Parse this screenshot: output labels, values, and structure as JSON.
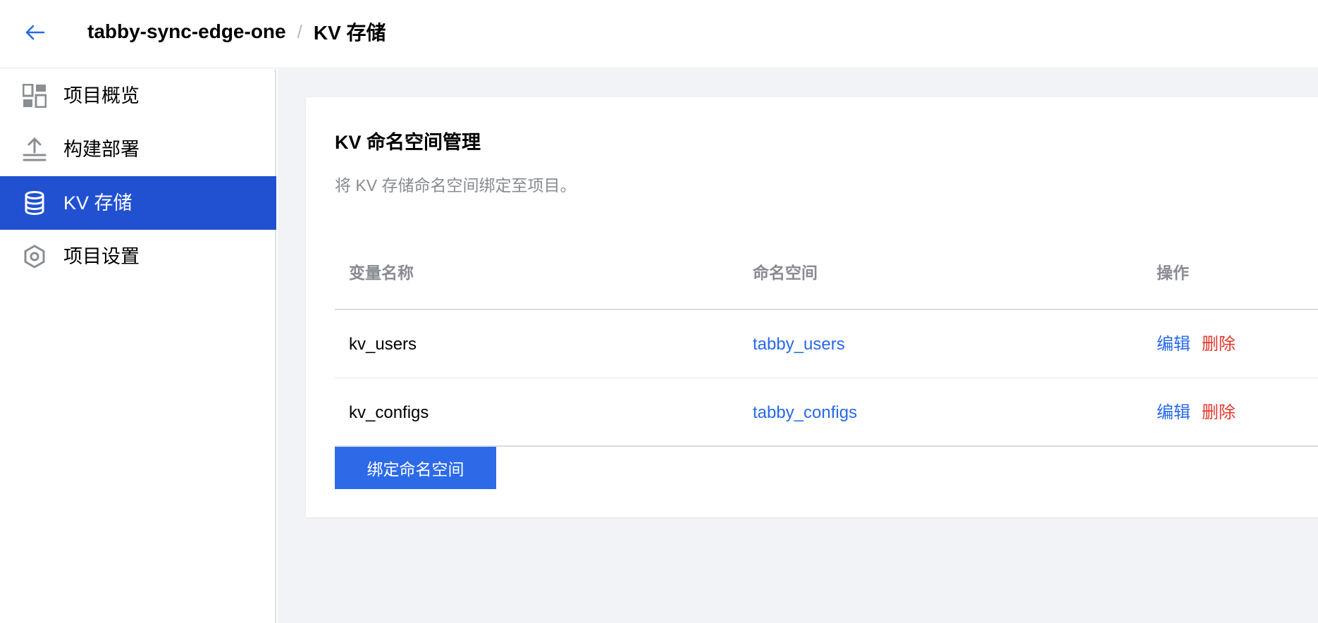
{
  "header": {
    "back_icon": "arrow-left-icon",
    "project_name": "tabby-sync-edge-one",
    "separator": "/",
    "current_page": "KV 存储"
  },
  "sidebar": {
    "items": [
      {
        "label": "项目概览",
        "icon": "dashboard-icon",
        "active": false
      },
      {
        "label": "构建部署",
        "icon": "upload-icon",
        "active": false
      },
      {
        "label": "KV 存储",
        "icon": "database-icon",
        "active": true
      },
      {
        "label": "项目设置",
        "icon": "hexagon-settings-icon",
        "active": false
      }
    ]
  },
  "main": {
    "card": {
      "title": "KV 命名空间管理",
      "description": "将 KV 存储命名空间绑定至项目。",
      "table": {
        "headers": [
          "变量名称",
          "命名空间",
          "操作"
        ],
        "rows": [
          {
            "variable": "kv_users",
            "namespace": "tabby_users",
            "edit": "编辑",
            "delete": "删除"
          },
          {
            "variable": "kv_configs",
            "namespace": "tabby_configs",
            "edit": "编辑",
            "delete": "删除"
          }
        ]
      },
      "bind_button": "绑定命名空间"
    }
  },
  "colors": {
    "accent": "#2151d1",
    "primary_button": "#2d6ae8",
    "link": "#2769e8",
    "danger": "#e5372c",
    "main_background": "#f2f3f7"
  }
}
